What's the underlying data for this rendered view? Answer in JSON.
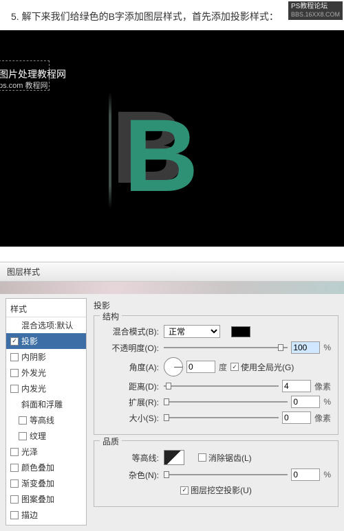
{
  "instruction": "5. 解下来我们给绿色的B字添加图层样式，首先添加投影样式：",
  "forum": {
    "line1": "PS教程论坛",
    "line2": "BBS.16XX8.COM"
  },
  "overlay": {
    "l1": "图片处理教程网",
    "l2": "ps.com 教程网"
  },
  "letter": "B",
  "dialog_title": "图层样式",
  "styles": {
    "header": "样式",
    "items": [
      {
        "label": "混合选项:默认",
        "checked": false,
        "header": true
      },
      {
        "label": "投影",
        "checked": true,
        "selected": true
      },
      {
        "label": "内阴影",
        "checked": false
      },
      {
        "label": "外发光",
        "checked": false
      },
      {
        "label": "内发光",
        "checked": false
      },
      {
        "label": "斜面和浮雕",
        "checked": false,
        "header": true
      },
      {
        "label": "等高线",
        "checked": false,
        "indent": true
      },
      {
        "label": "纹理",
        "checked": false,
        "indent": true
      },
      {
        "label": "光泽",
        "checked": false
      },
      {
        "label": "颜色叠加",
        "checked": false
      },
      {
        "label": "渐变叠加",
        "checked": false
      },
      {
        "label": "图案叠加",
        "checked": false
      },
      {
        "label": "描边",
        "checked": false
      }
    ]
  },
  "panel": {
    "title": "投影",
    "group_structure": "结构",
    "group_quality": "品质",
    "blend_label": "混合模式(B):",
    "blend_value": "正常",
    "opacity_label": "不透明度(O):",
    "opacity_value": "100",
    "angle_label": "角度(A):",
    "angle_value": "0",
    "angle_unit": "度",
    "global_light": "使用全局光(G)",
    "distance_label": "距离(D):",
    "distance_value": "4",
    "distance_unit": "像素",
    "spread_label": "扩展(R):",
    "spread_value": "0",
    "size_label": "大小(S):",
    "size_value": "0",
    "size_unit": "像素",
    "contour_label": "等高线:",
    "antialias": "消除锯齿(L)",
    "noise_label": "杂色(N):",
    "noise_value": "0",
    "knockout": "图层挖空投影(U)",
    "pct": "%"
  }
}
